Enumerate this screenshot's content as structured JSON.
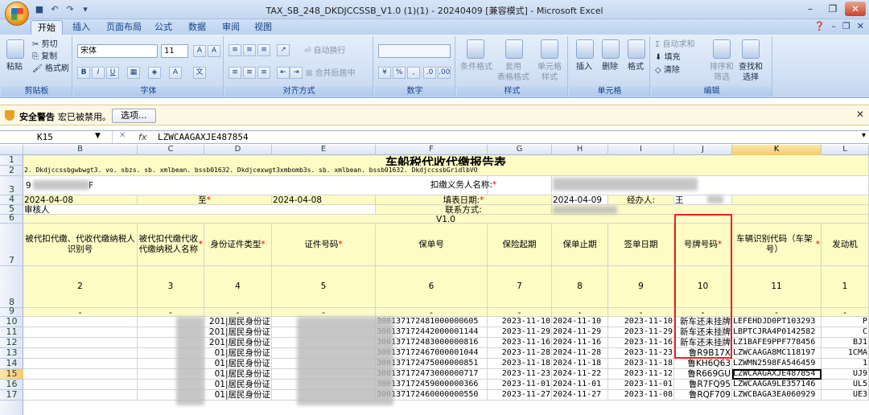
{
  "window": {
    "title": "TAX_SB_248_DKDJCCSSB_V1.0 (1)(1) - 20240409  [兼容模式] - Microsoft Excel"
  },
  "ribbon_tabs": [
    "开始",
    "插入",
    "页面布局",
    "公式",
    "数据",
    "审阅",
    "视图"
  ],
  "active_tab": "开始",
  "ribbon": {
    "clipboard": {
      "label": "剪贴板",
      "paste": "粘贴",
      "cut": "剪切",
      "copy": "复制",
      "format_painter": "格式刷"
    },
    "font": {
      "label": "字体",
      "name": "宋体",
      "size": "11"
    },
    "alignment": {
      "label": "对齐方式",
      "wrap": "自动换行",
      "merge": "合并后居中"
    },
    "number": {
      "label": "数字"
    },
    "styles": {
      "label": "样式",
      "conditional": "条件格式",
      "table": "套用\n表格格式",
      "cell": "单元格\n样式"
    },
    "cells": {
      "label": "单元格",
      "insert": "插入",
      "delete": "删除",
      "format": "格式"
    },
    "editing": {
      "label": "编辑",
      "autosum": "自动求和",
      "fill": "填充",
      "clear": "清除",
      "sort": "排序和\n筛选",
      "find": "查找和\n选择"
    }
  },
  "security_bar": {
    "title": "安全警告",
    "message": "宏已被禁用。",
    "button": "选项..."
  },
  "formula_bar": {
    "cell_ref": "K15",
    "fx": "fx",
    "value": "LZWCAAGAXJE487854"
  },
  "columns": [
    "B",
    "C",
    "D",
    "E",
    "F",
    "G",
    "H",
    "I",
    "J",
    "K",
    "L"
  ],
  "selected_column": "K",
  "rows": [
    "1",
    "2",
    "3",
    "4",
    "5",
    "6",
    "7",
    "8",
    "9",
    "10",
    "11",
    "12",
    "13",
    "14",
    "15",
    "16",
    "17"
  ],
  "selected_row": "15",
  "sheet": {
    "title": "车船税代收代缴报告表",
    "row2_b": "2. Dkdjccssbgwbwgt3. vo. sbzs. sb. xmlbean. bssb01632. Dkdjcexwgt3xmbomb3s. sb. xmlbean. bssb01632. DkdjccssbGridlbVO",
    "row3_b": "9",
    "row3_b2": "F",
    "withholder_label": "扣缴义务人名称:",
    "date_from": "2024-04-08",
    "date_to_label": "至",
    "date_to": "2024-04-08",
    "fill_date_label": "填表日期:",
    "fill_date": "2024-04-09",
    "handler_label": "经办人:",
    "handler_value": "王",
    "row5_b": "审核人",
    "contact_label": "联系方式:",
    "version": "V1.0",
    "req_mark": "*",
    "headers": [
      "被代扣代缴、代收代缴纳税人识别号",
      "被代扣代缴代收代缴纳税人名称",
      "身份证件类型",
      "证件号码",
      "保单号",
      "保险起期",
      "保单止期",
      "签单日期",
      "号牌号码",
      "车辆识别代码（车架号）",
      "发动机"
    ],
    "header_numbers": [
      "2",
      "3",
      "4",
      "5",
      "6",
      "7",
      "8",
      "9",
      "10",
      "11",
      "1"
    ],
    "dash": "-",
    "data_rows": [
      {
        "d": "201|居民身份证",
        "f": "300137172481000000605",
        "g": "2023-11-10",
        "h": "2024-11-10",
        "i": "2023-11-10",
        "j": "新车还未挂牌",
        "k": "LEFEHDJD0PT103293",
        "l": "P"
      },
      {
        "d": "201|居民身份证",
        "f": "300137172442000001144",
        "g": "2023-11-29",
        "h": "2024-11-29",
        "i": "2023-11-29",
        "j": "新车还未挂牌",
        "k": "LBPTCJRA4P0142582",
        "l": "C"
      },
      {
        "d": "201|居民身份证",
        "f": "300137172483000000816",
        "g": "2023-11-16",
        "h": "2024-11-16",
        "i": "2023-11-16",
        "j": "新车还未挂牌",
        "k": "LZ1BAFE9PPF778456",
        "l": "BJ1"
      },
      {
        "d": "01|居民身份证",
        "f": "300137172467000001044",
        "g": "2023-11-28",
        "h": "2024-11-28",
        "i": "2023-11-23",
        "j": "鲁R9B17X",
        "k": "LZWCAAGA8MC118197",
        "l": "1CMA"
      },
      {
        "d": "01|居民身份证",
        "f": "300137172475000000851",
        "g": "2023-11-18",
        "h": "2024-11-18",
        "i": "2023-11-18",
        "j": "鲁KH6Q63",
        "k": "LZWMN2598FA546459",
        "l": "1"
      },
      {
        "d": "01|居民身份证",
        "f": "300137172473000000717",
        "g": "2023-11-23",
        "h": "2024-11-22",
        "i": "2023-11-12",
        "j": "鲁R669GU",
        "k": "LZWCAAGAXJE487854",
        "l": "UJ9"
      },
      {
        "d": "01|居民身份证",
        "f": "300137172459000000366",
        "g": "2023-11-01",
        "h": "2024-11-01",
        "i": "2023-11-01",
        "j": "鲁R7FQ95",
        "k": "LZWCAAGA9LE357146",
        "l": "UL5"
      },
      {
        "d": "01|居民身份证",
        "f": "300137172460000000550",
        "g": "2023-11-27",
        "h": "2024-11-27",
        "i": "2023-11-08",
        "j": "鲁RQF709",
        "k": "LZWCBAGA3EA060929",
        "l": "UE3"
      }
    ]
  },
  "colors": {
    "header_yellow": "#fdfcc4",
    "highlight": "#e42323",
    "selection": "#f5c96a"
  }
}
